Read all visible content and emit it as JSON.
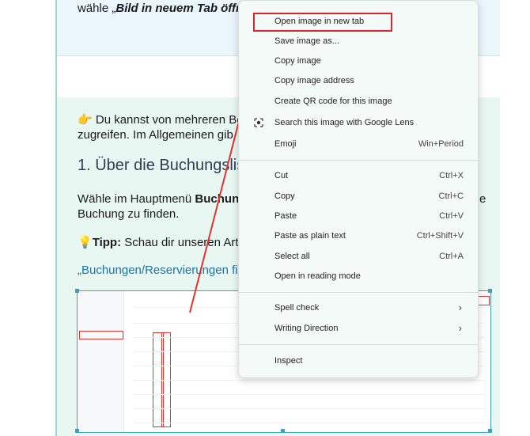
{
  "article": {
    "top_text_prefix": "wähle „",
    "top_text_bold": "Bild in neuem Tab öffn",
    "para1_emoji": "👉",
    "para1_line1": " Du kannst von mehreren Be",
    "para1_line2": "zugreifen. Im Allgemeinen gib",
    "heading": "1. Über die Buchungslis",
    "para2_prefix": "Wähle im Hauptmenü ",
    "para2_bold": "Buchun",
    "para2_suffix": "e",
    "para2_line2": "Buchung zu finden.",
    "tip_emoji": "💡",
    "tip_bold": "Tipp:",
    "tip_text": " Schau dir unseren Artil",
    "link_text": "„Buchungen/Reservierungen fi"
  },
  "context_menu": {
    "items": [
      {
        "label": "Open image in new tab",
        "shortcut": ""
      },
      {
        "label": "Save image as...",
        "shortcut": ""
      },
      {
        "label": "Copy image",
        "shortcut": ""
      },
      {
        "label": "Copy image address",
        "shortcut": ""
      },
      {
        "label": "Create QR code for this image",
        "shortcut": ""
      },
      {
        "label": "Search this image with Google Lens",
        "shortcut": "",
        "icon": "google-lens-icon"
      },
      {
        "label": "Emoji",
        "shortcut": "Win+Period"
      },
      {
        "label": "Cut",
        "shortcut": "Ctrl+X"
      },
      {
        "label": "Copy",
        "shortcut": "Ctrl+C"
      },
      {
        "label": "Paste",
        "shortcut": "Ctrl+V"
      },
      {
        "label": "Paste as plain text",
        "shortcut": "Ctrl+Shift+V"
      },
      {
        "label": "Select all",
        "shortcut": "Ctrl+A"
      },
      {
        "label": "Open in reading mode",
        "shortcut": ""
      },
      {
        "label": "Spell check",
        "shortcut": "",
        "submenu": true
      },
      {
        "label": "Writing Direction",
        "shortcut": "",
        "submenu": true
      },
      {
        "label": "Inspect",
        "shortcut": ""
      }
    ],
    "highlighted_item": "Open image in new tab"
  },
  "colors": {
    "highlight_box": "#d6262b",
    "arrow": "#e0342f",
    "menu_background": "#f4faf7",
    "link": "#1a73a8"
  }
}
